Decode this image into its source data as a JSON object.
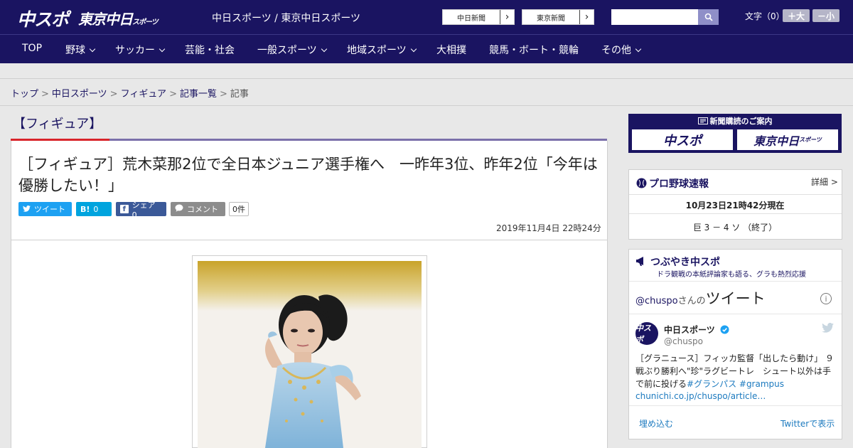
{
  "header": {
    "logo_chuspo": "中スポ",
    "logo_tokyo": "東京中日",
    "logo_tokyo_small": "スポーツ",
    "site_names": "中日スポーツ / 東京中日スポーツ",
    "ext_links": [
      "中日新聞",
      "東京新聞"
    ],
    "ext_arrow": "›",
    "search_placeholder": "",
    "text_size_label": "文字（0）",
    "size_plus": "＋大",
    "size_minus": "－小"
  },
  "nav": {
    "items": [
      {
        "label": "TOP"
      },
      {
        "label": "野球"
      },
      {
        "label": "サッカー"
      },
      {
        "label": "芸能・社会"
      },
      {
        "label": "一般スポーツ"
      },
      {
        "label": "地域スポーツ"
      },
      {
        "label": "大相撲"
      },
      {
        "label": "競馬・ボート・競輪"
      },
      {
        "label": "その他"
      }
    ]
  },
  "breadcrumb": {
    "items": [
      "トップ",
      "中日スポーツ",
      "フィギュア",
      "記事一覧",
      "記事"
    ],
    "sep": ">"
  },
  "article": {
    "section": "【フィギュア】",
    "headline": "［フィギュア］荒木菜那2位で全日本ジュニア選手権へ　一昨年3位、昨年2位「今年は優勝したい！」",
    "share": {
      "tweet_icon": "🐦",
      "tweet": "ツイート",
      "hatena_icon": "B!",
      "hatena_count": "0",
      "fb_icon": "f",
      "fb": "シェア 0",
      "comment_icon": "💬",
      "comment": "コメント",
      "comment_count": "0件"
    },
    "date": "2019年11月4日 22時24分"
  },
  "sidebar": {
    "subscribe": {
      "title": "新聞購読のご案内",
      "btn_chuspo": "中スポ",
      "btn_tokyo": "東京中日",
      "btn_tokyo_small": "スポーツ"
    },
    "baseball": {
      "title": "プロ野球速報",
      "link": "詳細 >",
      "time": "10月23日21時42分現在",
      "score": "巨 3 － 4 ソ （終了）"
    },
    "tweets": {
      "title": "つぶやき中スポ",
      "subtitle": "ドラ観戦の本紙評論家も語る、グラも熱烈応援",
      "handle_line_user": "@chuspo",
      "handle_line_suffix": "さんの",
      "handle_line_big": "ツイート",
      "info": "i",
      "account_name": "中日スポーツ",
      "account_handle": "@chuspo",
      "avatar": "中スポ",
      "tweet_text": "［グラニュース］フィッカ監督「出したら動け」 ９戦ぶり勝利へ\"珍\"ラグビートレ　シュート以外は手で前に投げる",
      "tweet_tags": "#グランパス #grampus",
      "tweet_link": "chunichi.co.jp/chuspo/article…",
      "embed": "埋め込む",
      "view_on_twitter": "Twitterで表示"
    }
  },
  "colors": {
    "navy": "#1a1461",
    "red": "#d9242b",
    "twitter": "#1da1f2",
    "hatena": "#00a4de",
    "facebook": "#3b5998"
  }
}
